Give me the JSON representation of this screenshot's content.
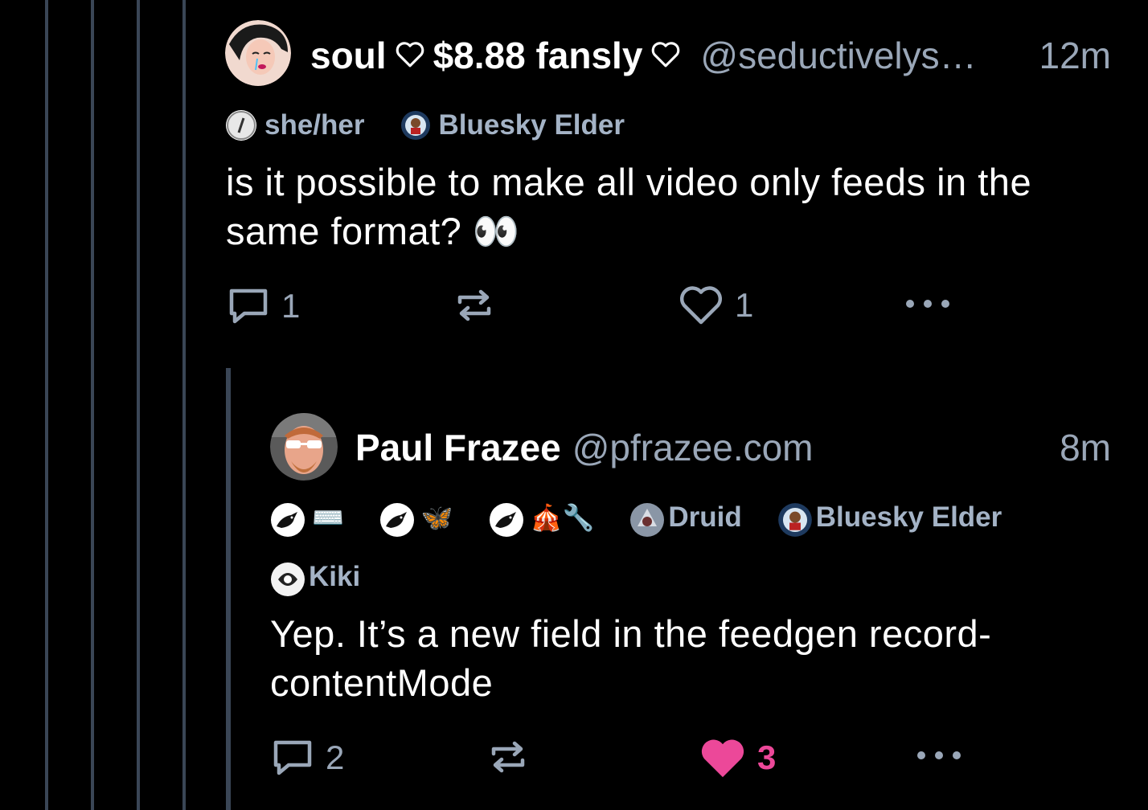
{
  "parent_post": {
    "display_name": "soul",
    "name_part2": "$8.88 fansly",
    "handle": "@seductivelys…",
    "time": "12m",
    "labels": [
      {
        "name": "she/her",
        "icon": "slash-circle-icon"
      },
      {
        "name": "Bluesky Elder",
        "icon": "elder-badge-icon"
      }
    ],
    "text": "is it possible to make all video only feeds in the same format? 👀",
    "actions": {
      "reply_count": "1",
      "like_count": "1"
    }
  },
  "reply_post": {
    "display_name": "Paul Frazee",
    "handle": "@pfrazee.com",
    "time": "8m",
    "labels": [
      {
        "name": "⌨️",
        "icon": "bird-icon"
      },
      {
        "name": "🦋",
        "icon": "bird-icon"
      },
      {
        "name": "🎪🔧",
        "icon": "bird-icon"
      },
      {
        "name": "Druid",
        "icon": "druid-badge-icon"
      },
      {
        "name": "Bluesky Elder",
        "icon": "elder-badge-icon"
      },
      {
        "name": "Kiki",
        "icon": "kiki-icon"
      }
    ],
    "text": "Yep. It’s a new field in the feedgen record-contentMode",
    "actions": {
      "reply_count": "2",
      "like_count": "3",
      "liked": true
    }
  },
  "colors": {
    "background": "#000000",
    "thread_line": "#3a4656",
    "muted": "#9aa7b8",
    "label": "#a4b3c6",
    "like_active": "#ec4899"
  }
}
